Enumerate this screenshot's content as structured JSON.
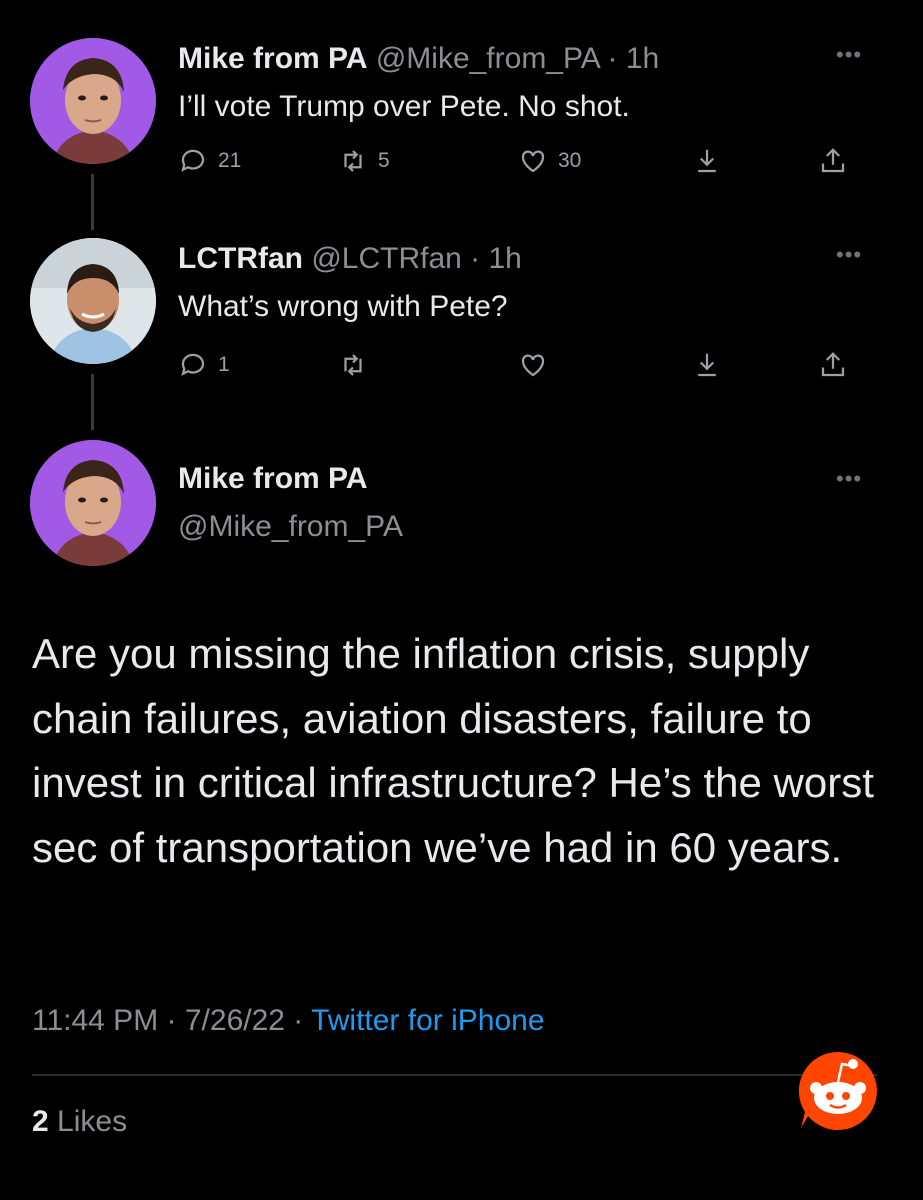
{
  "colors": {
    "background": "#000000",
    "text": "#e7e9ea",
    "muted": "#8b8f94",
    "link": "#1d9bf0",
    "reddit": "#ff4500"
  },
  "tweets": [
    {
      "name": "Mike from PA",
      "handle": "@Mike_from_PA",
      "time": "1h",
      "text": "I’ll vote Trump over Pete. No shot.",
      "replies": "21",
      "retweets": "5",
      "likes": "30"
    },
    {
      "name": "LCTRfan",
      "handle": "@LCTRfan",
      "time": "1h",
      "text": "What’s wrong with Pete?",
      "replies": "1",
      "retweets": "",
      "likes": ""
    }
  ],
  "main_tweet": {
    "name": "Mike from PA",
    "handle": "@Mike_from_PA",
    "text": "Are you missing the inflation crisis, supply chain failures, aviation disasters, failure to invest in critical infrastructure? He’s the worst sec of transportation we’ve had in 60 years.",
    "time": "11:44 PM",
    "date": "7/26/22",
    "source": "Twitter for iPhone",
    "likes_count": "2",
    "likes_label": "Likes"
  },
  "icons": {
    "more": "more-dots-icon",
    "reply": "reply-icon",
    "retweet": "retweet-icon",
    "like": "heart-icon",
    "bookmark": "bookmark-down-icon",
    "share": "share-icon",
    "watermark": "reddit-logo"
  }
}
